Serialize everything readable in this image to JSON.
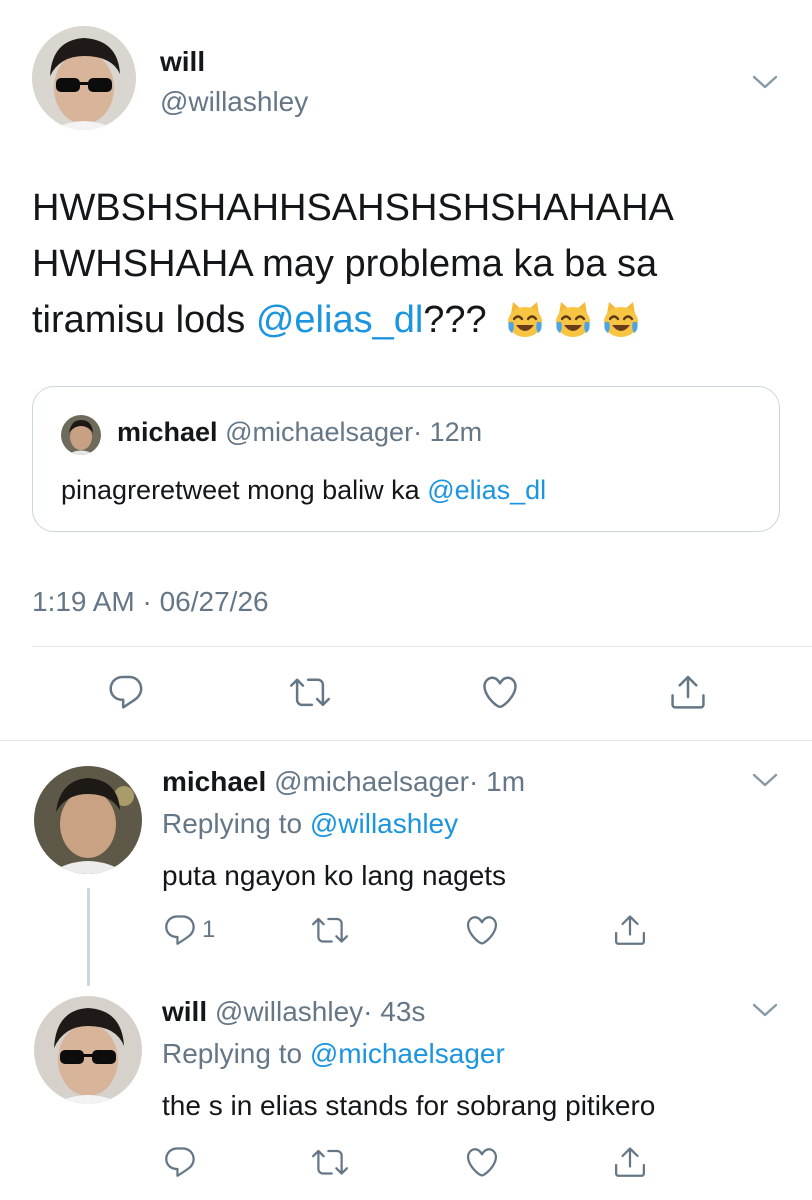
{
  "main_tweet": {
    "name": "will",
    "handle": "@willashley",
    "text_line1": "HWBSHSHAHHSAHSHSHSHAHAHA",
    "text_line2": "HWHSHAHA may problema ka ba sa",
    "text_line3_prefix": "tiramisu lods ",
    "mention": "@elias_dl",
    "text_line3_suffix": "???",
    "emojis": [
      "joy-cat-emoji",
      "joy-cat-emoji",
      "joy-cat-emoji"
    ],
    "timestamp": "1:19 AM · 06/27/26"
  },
  "quoted_tweet": {
    "name": "michael",
    "handle": "@michaelsager",
    "time": "· 12m",
    "text": "pinagreretweet mong baliw ka ",
    "mention": "@elias_dl"
  },
  "replies": [
    {
      "name": "michael",
      "handle": "@michaelsager",
      "time": "· 1m",
      "replying_label": "Replying to ",
      "replying_to": "@willashley",
      "text": "puta ngayon ko lang nagets",
      "reply_count": "1"
    },
    {
      "name": "will",
      "handle": "@willashley",
      "time": "· 43s",
      "replying_label": "Replying to ",
      "replying_to": "@michaelsager",
      "text": "the s in elias stands for sobrang pitikero",
      "reply_count": ""
    }
  ],
  "icons": {
    "reply": "reply-icon",
    "retweet": "retweet-icon",
    "like": "like-icon",
    "share": "share-icon",
    "menu": "chevron-down-icon"
  },
  "colors": {
    "link": "#1b95e0",
    "muted": "#657786",
    "divider": "#e1e8ed",
    "text": "#14171a"
  }
}
